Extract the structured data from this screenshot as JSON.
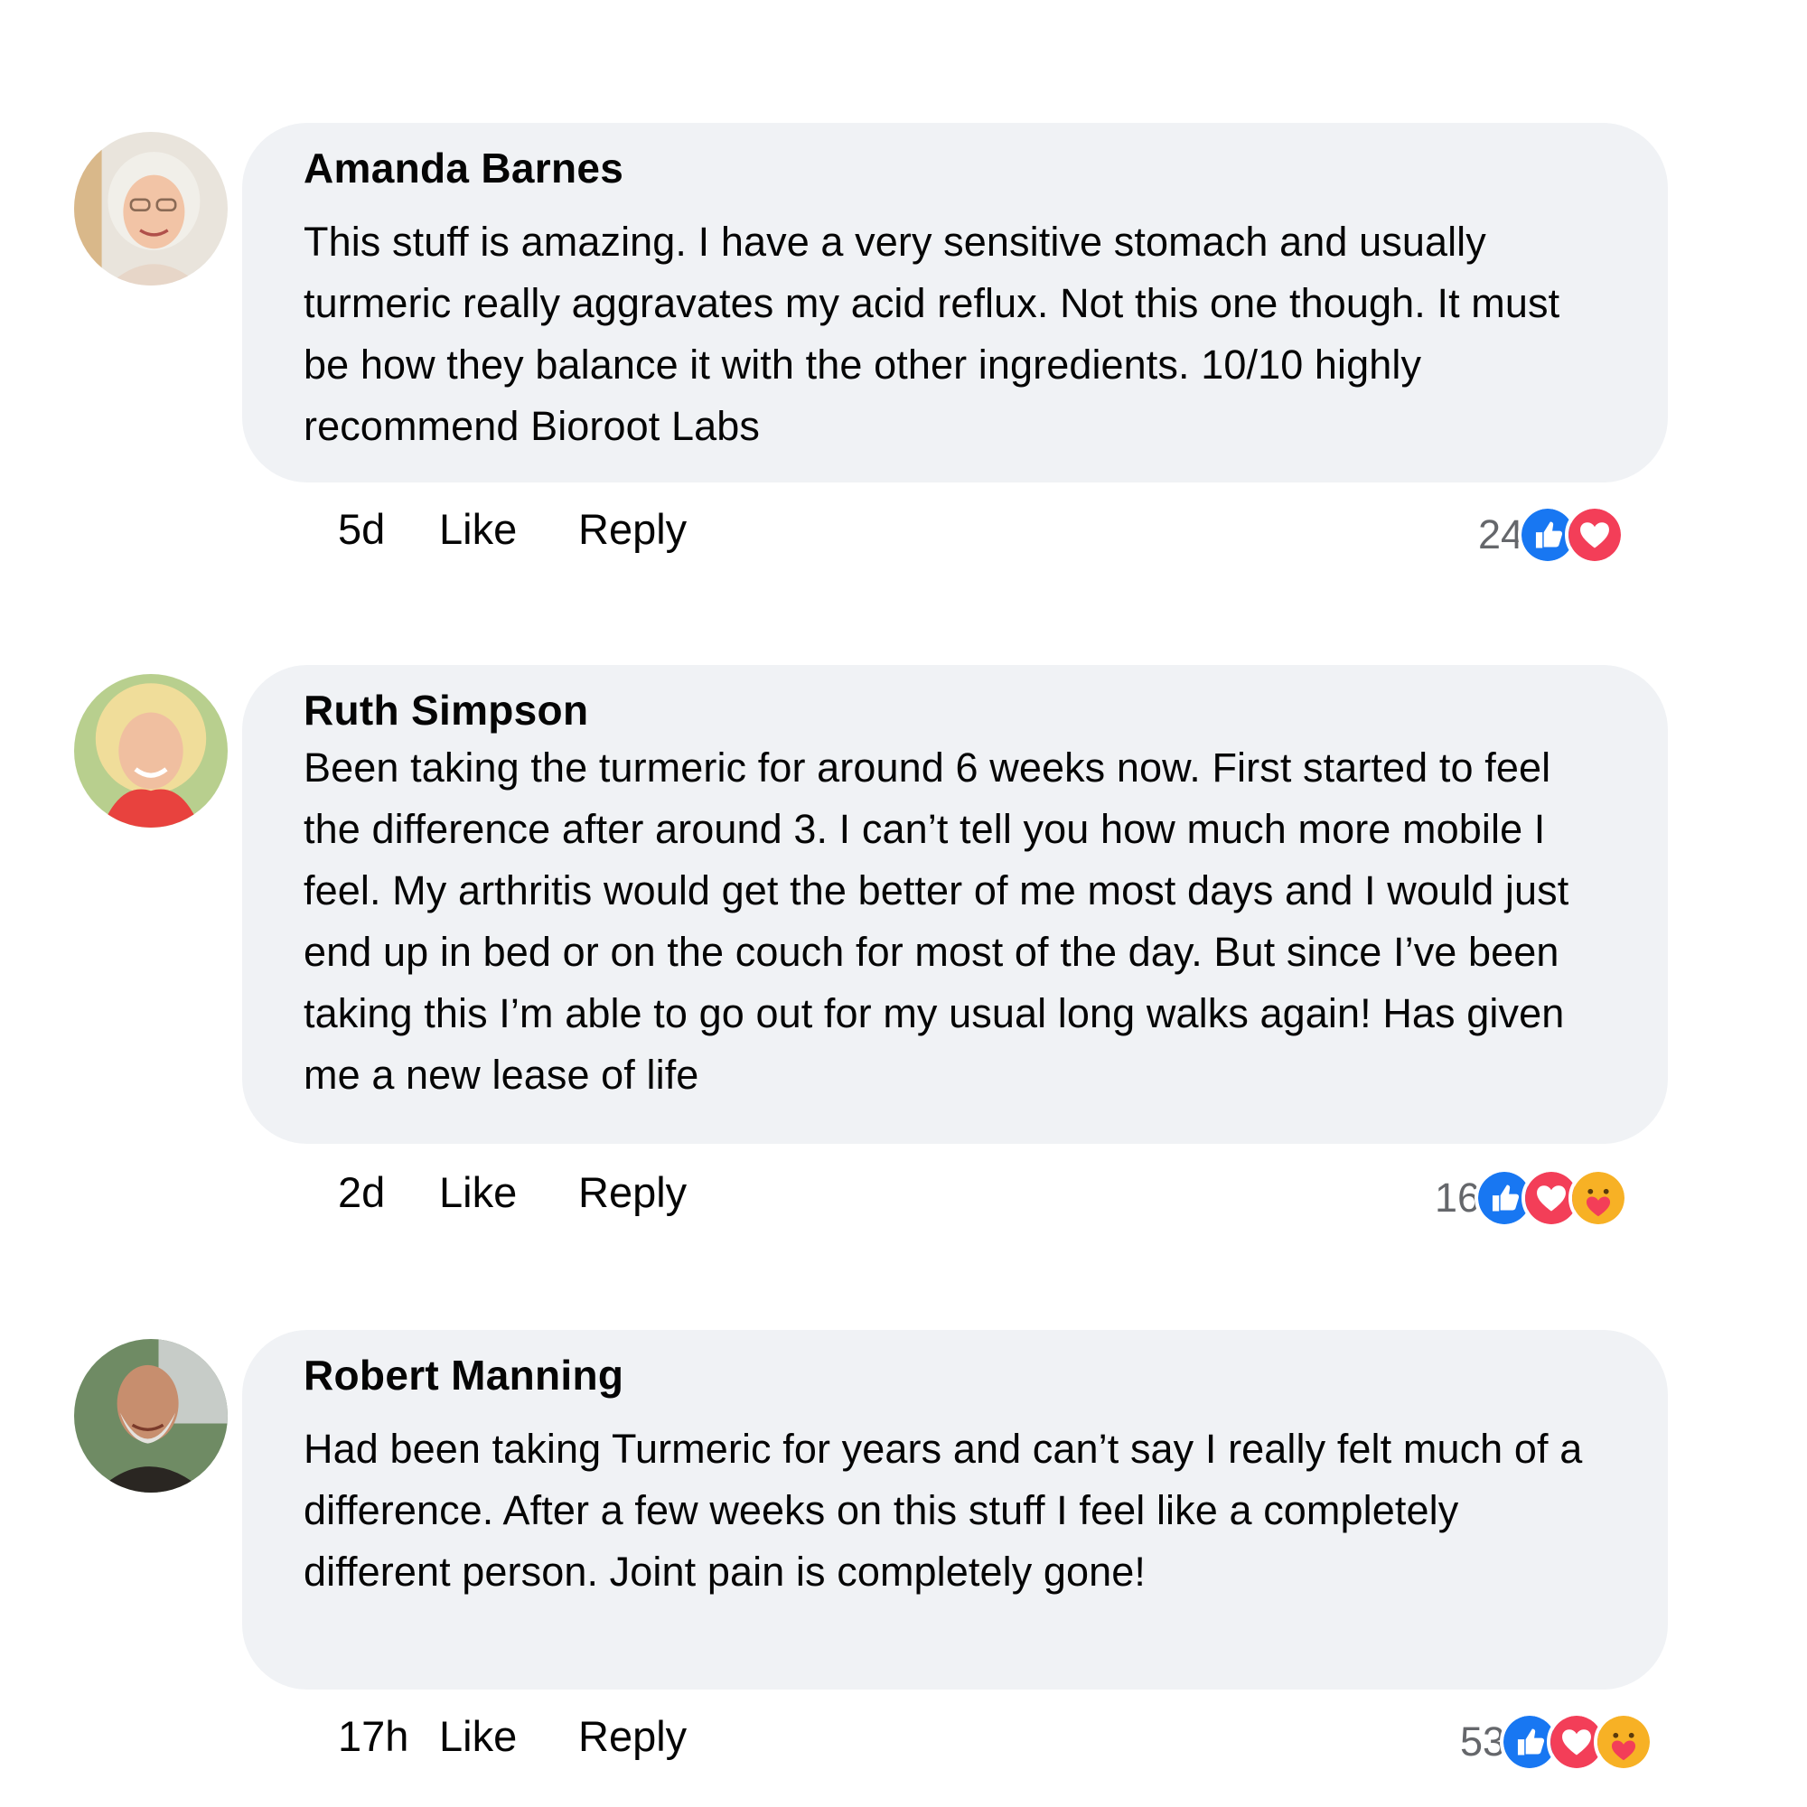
{
  "comments": [
    {
      "author": "Amanda Barnes",
      "text": "This stuff is amazing. I have a very sensitive stomach and usually turmeric really aggravates my acid reflux. Not this one though. It must be how they balance it with the other ingredients. 10/10 highly recommend Bioroot Labs",
      "time": "5d",
      "like_label": "Like",
      "reply_label": "Reply",
      "reaction_count": "24",
      "reactions": [
        "like-icon",
        "love-icon"
      ]
    },
    {
      "author": "Ruth Simpson",
      "text": "Been taking the turmeric for around 6 weeks now. First started to feel the difference after around 3. I can’t tell you how much more mobile I feel. My arthritis would get the better of me most days and I would just end up in bed or on the couch for most of the day. But since I’ve been taking this I’m able to go out for my usual long walks again! Has given me a new lease of life",
      "time": "2d",
      "like_label": "Like",
      "reply_label": "Reply",
      "reaction_count": "16",
      "reactions": [
        "like-icon",
        "love-icon",
        "care-icon"
      ]
    },
    {
      "author": "Robert Manning",
      "text": "Had been taking Turmeric for years and can’t say I really felt much of a difference. After a few weeks on this stuff I feel like a completely different person. Joint pain is completely gone!",
      "time": "17h",
      "like_label": "Like",
      "reply_label": "Reply",
      "reaction_count": "53",
      "reactions": [
        "like-icon",
        "love-icon",
        "care-icon"
      ]
    }
  ],
  "colors": {
    "bubble_bg": "#f0f2f5",
    "like_blue": "#1877f2",
    "love_red": "#f33e58",
    "care_yellow": "#f7b125",
    "meta_gray": "#65676b"
  }
}
